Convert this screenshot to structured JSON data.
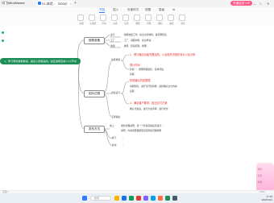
{
  "titlebar": {
    "app_name": "讯飞MindMaster",
    "tab_label": "01-体验...（0000）",
    "tab_close": "×",
    "new_tab": "+",
    "vip_label": "开通会员 VIP",
    "win_min": "—",
    "win_max": "□",
    "win_close": "✕"
  },
  "toolbar": {
    "menus": [
      "开始",
      "插入",
      "页面样式",
      "视图",
      "高级",
      "AI"
    ],
    "active_menu": "开始",
    "tools": [
      "主题",
      "子主题",
      "浮动",
      "关系",
      "标注",
      "概要",
      "外框",
      "图标",
      "格式",
      "布局"
    ]
  },
  "mindmap": {
    "root": "1、学习软件技能前提、提出人员相关的、适应进场完成1.1小节中",
    "branches": [
      {
        "label": "前期准备",
        "children": [
          "多元",
          "工厂",
          "收尾"
        ],
        "notes": [
          "·  前期准备工作，提交全部材料，等待审核及...",
          "·  工厂、领取材料、提交申请、...",
          "·  收尾：阶段结算，整理..."
        ]
      },
      {
        "label": "实际过程",
        "children": [
          "功能规划",
          "方案设计",
          "下游输出"
        ],
        "red_notes": [
          "1、预计输出功能完整结构，以及相关流程的设计以及分析",
          "预计时间",
          "阶段输出内容整理",
          "2、满足客户要求，提出交付方案"
        ],
        "notes": [
          "阶段一：整理预期目标，需求评估",
          "初期",
          "中期阶段：进行可行性判断，最终确认交付内容",
          "后期",
          "确认方案后，进行方案评审，进行优化"
        ]
      },
      {
        "label": "发布方式",
        "children": [
          "线上",
          "线下",
          "补充"
        ],
        "notes": [
          "发布流程说明：第一个阶段完成后需进行...",
          "说明：内容需要根据项目实际情况做调整",
          "·  ...",
          "·  ..."
        ]
      }
    ]
  },
  "decoration": [
    "限时",
    "会员",
    "特惠"
  ],
  "statusbar": {
    "page": "页面-1",
    "zoom": "100%"
  },
  "taskbar": {
    "search_placeholder": "搜索",
    "time": "17:15",
    "date": "2024/3/12"
  }
}
